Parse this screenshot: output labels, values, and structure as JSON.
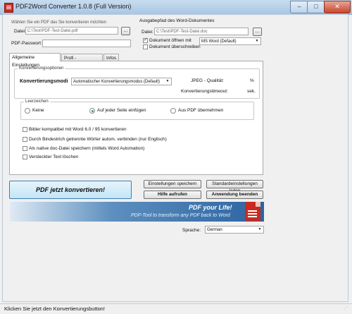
{
  "window": {
    "title": "PDF2Word Converter 1.0.8 (Full Version)",
    "minimize": "–",
    "maximize": "□",
    "close": "✕"
  },
  "pdf_section": {
    "heading": "Wählen Sie ein PDF das Sie konvertieren möchten",
    "file_label": "Datei:",
    "file_value": "C:\\Test\\PDF-Test-Datei.pdf",
    "browse": "...",
    "password_label": "PDF-Passwort:"
  },
  "output_section": {
    "heading": "Ausgabepfad des Word-Dokumentes",
    "file_label": "Datei:",
    "file_value": "C:\\Test\\PDF-Test-Datei.doc",
    "browse": "...",
    "open_with_label": "Dokument öffnen mit",
    "open_with_checked": true,
    "open_with_app": "MS Word (Default)",
    "overwrite_label": "Dokument überschreiben",
    "overwrite_checked": false
  },
  "tabs": [
    {
      "label": "Allgemeine Einstellungen",
      "active": true
    },
    {
      "label": "Profi - Einstellungen",
      "active": false
    },
    {
      "label": "Infos",
      "active": false
    }
  ],
  "conversion_options": {
    "legend": "Konvertierungsoptionen",
    "mode_label": "Konvertierungsmodi",
    "mode_value": "Automatischer Konvertierungsmodus (Default)",
    "jpeg_label": "JPEG - Qualität:",
    "jpeg_unit": "%",
    "timeout_label": "Konvertierungstimeout:",
    "timeout_unit": "sek."
  },
  "page_break": {
    "legend": "Leerzeichen",
    "options": [
      {
        "label": "Keine",
        "selected": false
      },
      {
        "label": "Auf jeder Seite einfügen",
        "selected": true
      },
      {
        "label": "Aus PDF übernehmen",
        "selected": false
      }
    ]
  },
  "checkboxes": [
    {
      "label": "Bilder kompatibel mit Word 6.0 / 95 konvertieren",
      "checked": false
    },
    {
      "label": "Durch Bindestrich getrennte Wörter autom. verbinden (nur Englisch)",
      "checked": false
    },
    {
      "label": "Als native doc-Datei speichern (mittels Word Automation)",
      "checked": false
    },
    {
      "label": "Versteckter Text löschen",
      "checked": false
    }
  ],
  "actions": {
    "convert": "PDF jetzt konvertieren!",
    "save_settings": "Einstellungen speichern",
    "default_settings": "Standardeinstellungen laden",
    "help": "Hilfe aufrufen",
    "exit": "Anwendung beenden"
  },
  "banner": {
    "headline": "PDF your Life!",
    "tagline": "PDF-Tool to transform any PDF back to Word"
  },
  "language": {
    "label": "Sprache:",
    "value": "German"
  },
  "status": "Klicken Sie jetzt den Konvertierungsbutton!",
  "colors": {
    "title_bar": "#a9c6e4",
    "convert_button": "#cde9f7",
    "banner_blue": "#2b64a1",
    "pdf_red": "#c92a1f"
  }
}
